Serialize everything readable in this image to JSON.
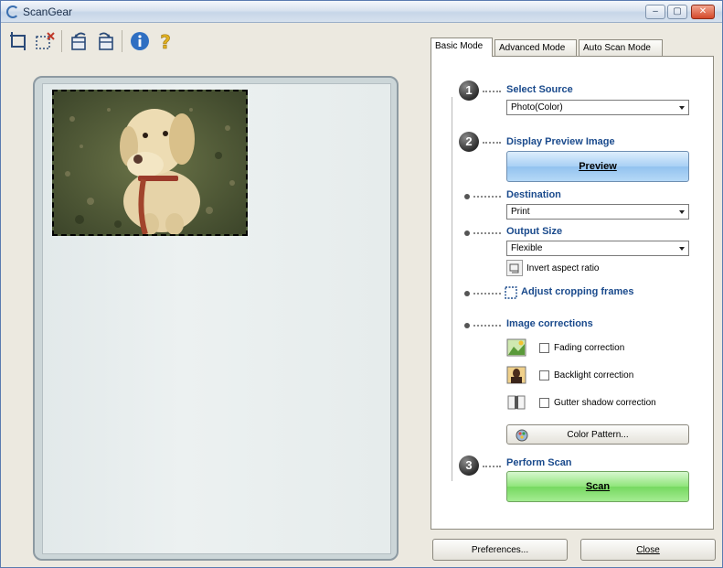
{
  "window": {
    "title": "ScanGear"
  },
  "titlebar": {
    "minimize": "–",
    "maximize": "▢",
    "close": "✕"
  },
  "tabs": [
    {
      "label": "Basic Mode"
    },
    {
      "label": "Advanced Mode"
    },
    {
      "label": "Auto Scan Mode"
    }
  ],
  "steps": {
    "select_source": {
      "number": "1",
      "title": "Select Source",
      "value": "Photo(Color)"
    },
    "display_preview": {
      "number": "2",
      "title": "Display Preview Image",
      "button": "Preview"
    },
    "destination": {
      "title": "Destination",
      "value": "Print"
    },
    "output_size": {
      "title": "Output Size",
      "value": "Flexible",
      "invert_label": "Invert aspect ratio"
    },
    "crop": {
      "title": "Adjust cropping frames"
    },
    "corrections": {
      "title": "Image corrections",
      "fading": "Fading correction",
      "backlight": "Backlight correction",
      "gutter": "Gutter shadow correction",
      "color_pattern": "Color Pattern..."
    },
    "perform_scan": {
      "number": "3",
      "title": "Perform Scan",
      "button": "Scan"
    }
  },
  "footer": {
    "preferences": "Preferences...",
    "close": "Close"
  }
}
